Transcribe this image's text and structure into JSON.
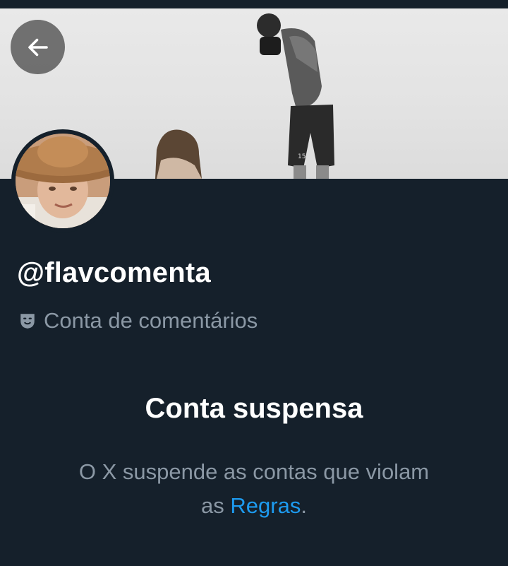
{
  "profile": {
    "handle": "@flavcomenta",
    "label": "Conta de comentários",
    "label_icon": "theater-mask-icon"
  },
  "suspension": {
    "title": "Conta suspensa",
    "message_part1": "O X suspende as contas que violam as ",
    "rules_link": "Regras",
    "message_end": "."
  },
  "colors": {
    "background": "#15202b",
    "text_primary": "#ffffff",
    "text_secondary": "#8b98a5",
    "link": "#1d9bf0"
  }
}
